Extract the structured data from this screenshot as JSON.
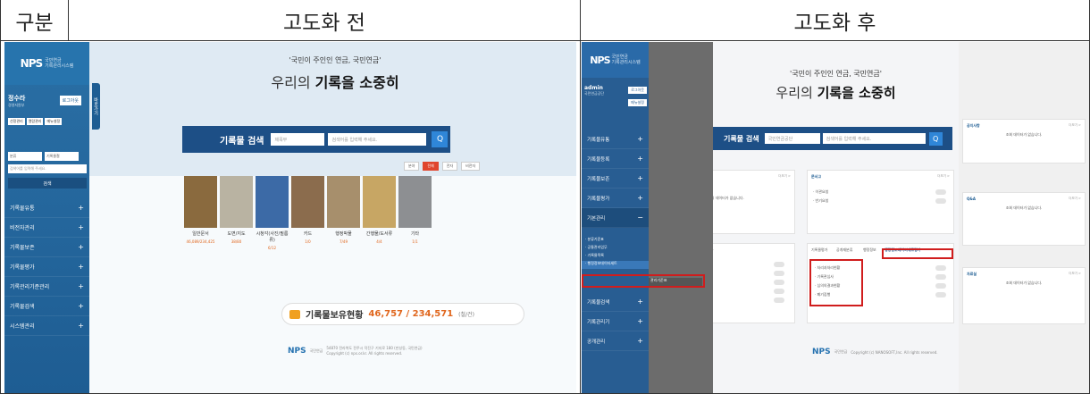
{
  "table": {
    "col_label": "구분",
    "before": "고도화 전",
    "after": "고도화 후"
  },
  "before": {
    "logo": {
      "brand": "NPS",
      "line1": "국민연금",
      "line2": "기록관리시스템"
    },
    "user": {
      "name": "정수라",
      "dept": "경영지원부",
      "logout": "로그아웃"
    },
    "quick": [
      "선정관리",
      "열람관리",
      "메뉴설정"
    ],
    "search": {
      "select1": "분류",
      "select2": "기록물철",
      "placeholder": "검색어를 입력해 주세요.",
      "button": "검색"
    },
    "menu": [
      "기록물유통",
      "비전자관리",
      "기록물보존",
      "기록물평가",
      "기록관리기준관리",
      "기록물검색",
      "시스템관리"
    ],
    "side_tab": "바로가기",
    "slogan1": "'국민이 주인인 연금, 국민연금'",
    "slogan1_hl": "국민",
    "slogan2_a": "우리의 ",
    "slogan2_b": "기록을 소중히",
    "searchbar": {
      "label": "기록물 검색",
      "field1": "제목부",
      "field2": "검색어를 입력해 주세요.",
      "go": "Q"
    },
    "filters": [
      "분야",
      "전체",
      "전자",
      "비전자"
    ],
    "cards": [
      {
        "label": "일반문서",
        "count": "46,089/234,425",
        "color": "#8a6a3e"
      },
      {
        "label": "도면/지도",
        "count": "38/80",
        "color": "#b9b3a2"
      },
      {
        "label": "시청각(사진/필름류)",
        "count": "6/12",
        "color": "#3c6aa6"
      },
      {
        "label": "카드",
        "count": "1/0",
        "color": "#8b6c4d"
      },
      {
        "label": "행정박물",
        "count": "7/49",
        "color": "#a78f6c"
      },
      {
        "label": "간행물/도서류",
        "count": "4/4",
        "color": "#c7a664"
      },
      {
        "label": "기타",
        "count": "1/1",
        "color": "#8d8f92"
      }
    ],
    "total": {
      "label": "기록물보유현황",
      "value": "46,757 / 234,571",
      "unit": "(철/건)"
    },
    "footer": {
      "brand": "NPS",
      "text": "국민연금",
      "small": "54870 전라북도 전주시 덕진구 기지로 180 (만성동, 국민연금) Copyright (c) nps.or.kr. All rights reserved."
    }
  },
  "after": {
    "logo": {
      "brand": "NPS",
      "line1": "국민연금",
      "line2": "기록관리시스템"
    },
    "user": {
      "name": "admin",
      "dept": "국민연금공단",
      "logout": "로그아웃",
      "menu": "메뉴설정"
    },
    "menu": [
      "기록물유통",
      "기록물등록",
      "기록물보존",
      "기록물평가",
      "기본관리"
    ],
    "sub": [
      "· 분류기준표",
      "· 공통관리업무",
      "· 기록물목록",
      "· 행정정보데이터세트"
    ],
    "menu2": [
      "기록물검색",
      "기록관리기",
      "공개관리"
    ],
    "flyout": "관리기준표",
    "slogan1": "'국민이 주인인 연금, 국민연금'",
    "slogan2_a": "우리의 ",
    "slogan2_b": "기록을 소중히",
    "searchbar": {
      "label": "기록물 검색",
      "field1": "국민연금공단",
      "field2": "검색어를 입력해 주세요.",
      "go": "Q"
    },
    "box1": {
      "title": "열람현황관리",
      "more": "더보기 >",
      "empty": "조회 데이터가 없습니다."
    },
    "box2": {
      "title": "문서고",
      "more": "더보기 >",
      "items": [
        "· 이관요청",
        "· 반기요청"
      ]
    },
    "box3": {
      "tabs": [
        "단위업무",
        "기록물철/ 역사"
      ],
      "items": []
    },
    "box4": {
      "tabs": [
        "기록물평가",
        "공개재분류",
        "행정정보",
        "행정정보데이터세트평가"
      ],
      "items": [
        "· 처리과처리현황",
        "· 기록관심사",
        "· 심의의결과현황",
        "· 폐기집행"
      ]
    },
    "r1": {
      "title": "공지사항",
      "more": "더보기 >",
      "empty": "조회 데이터가 없습니다."
    },
    "r2": {
      "title": "Q&A",
      "more": "더보기 >",
      "empty": "조회 데이터가 없습니다."
    },
    "r3": {
      "title": "자료실",
      "more": "더보기 >",
      "empty": "조회 데이터가 없습니다."
    },
    "footer": {
      "brand": "NPS",
      "text": "국민연금",
      "small": "Copyright (c) NANOSOFT,Inc. All rights reserved."
    }
  }
}
